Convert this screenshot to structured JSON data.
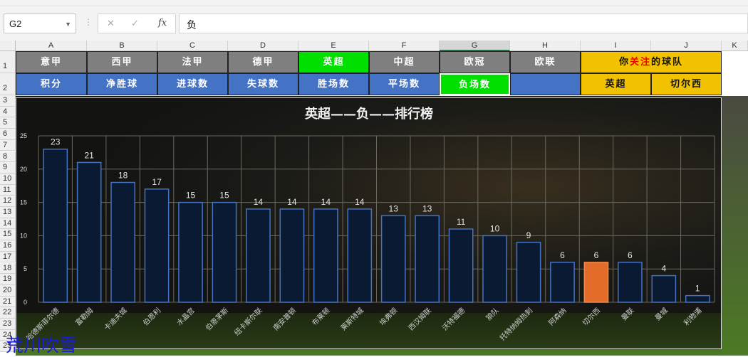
{
  "formula_bar": {
    "name_box": "G2",
    "cancel_icon": "✕",
    "enter_icon": "✓",
    "fx_label": "fx",
    "formula": "负"
  },
  "columns": [
    "A",
    "B",
    "C",
    "D",
    "E",
    "F",
    "G",
    "H",
    "I",
    "J",
    "K"
  ],
  "rows": [
    "1",
    "2",
    "3",
    "4",
    "5",
    "6",
    "7",
    "8",
    "9",
    "10",
    "11",
    "12",
    "13",
    "14",
    "15",
    "16",
    "17",
    "18",
    "19",
    "20",
    "21",
    "22",
    "23",
    "24",
    "25"
  ],
  "row1": [
    "意甲",
    "西甲",
    "法甲",
    "德甲",
    "英超",
    "中超",
    "欧冠",
    "欧联"
  ],
  "row2": [
    "积分",
    "净胜球",
    "进球数",
    "失球数",
    "胜场数",
    "平场数",
    "负场数",
    ""
  ],
  "follow": {
    "prefix": "你",
    "highlight": "关注",
    "suffix": "的球队",
    "league": "英超",
    "team": "切尔西"
  },
  "watermark": "荒川吹雪",
  "colors": {
    "bar": "#0b1a33",
    "bar_border": "#4472c4",
    "highlight": "#e46c2a"
  },
  "chart_data": {
    "type": "bar",
    "title": "英超——负——排行榜",
    "categories": [
      "哈德斯菲尔德",
      "富勒姆",
      "卡迪夫城",
      "伯恩利",
      "水晶宫",
      "伯恩茅斯",
      "纽卡斯尔联",
      "南安普顿",
      "布莱顿",
      "莱斯特城",
      "埃弗顿",
      "西汉姆联",
      "沃特福德",
      "狼队",
      "托特纳姆热刺",
      "阿森纳",
      "切尔西",
      "曼联",
      "曼城",
      "利物浦"
    ],
    "values": [
      23,
      21,
      18,
      17,
      15,
      15,
      14,
      14,
      14,
      14,
      13,
      13,
      11,
      10,
      9,
      6,
      6,
      6,
      4,
      1
    ],
    "highlight": "切尔西",
    "yticks": [
      0,
      5,
      10,
      15,
      20,
      25
    ],
    "ylim": [
      0,
      25
    ],
    "xlabel": "",
    "ylabel": "",
    "grid": true
  }
}
